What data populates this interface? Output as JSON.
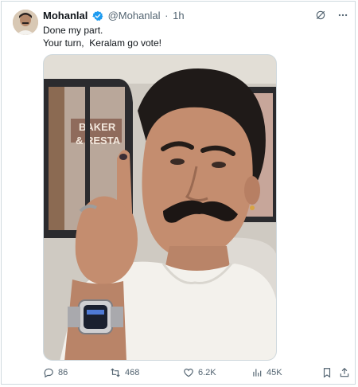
{
  "tweet": {
    "author_name": "Mohanlal",
    "handle": "@Mohanlal",
    "separator": "·",
    "time": "1h",
    "lines": [
      "Done my part.",
      "Your turn,  Keralam go vote!"
    ]
  },
  "photo": {
    "sign_text_1": "BAKER",
    "sign_text_2": "& RESTA"
  },
  "stats": {
    "replies": "86",
    "reposts": "468",
    "likes": "6.2K",
    "views": "45K"
  },
  "colors": {
    "verified": "#1d9bf0",
    "text": "#0f1419",
    "muted": "#536471"
  },
  "icons": [
    "verified-badge-icon",
    "grok-icon",
    "more-icon",
    "reply-icon",
    "repost-icon",
    "like-icon",
    "views-icon",
    "bookmark-icon",
    "share-icon"
  ]
}
